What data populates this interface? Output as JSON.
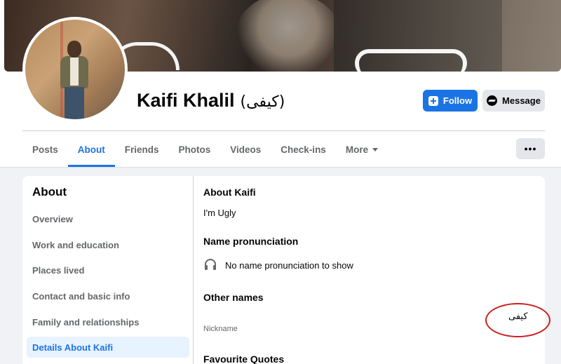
{
  "profile": {
    "name": "Kaifi Khalil",
    "alt_name": "(کیفی)"
  },
  "actions": {
    "follow_label": "Follow",
    "message_label": "Message",
    "more_dots": "•••"
  },
  "tabs": [
    {
      "label": "Posts"
    },
    {
      "label": "About",
      "active": true
    },
    {
      "label": "Friends"
    },
    {
      "label": "Photos"
    },
    {
      "label": "Videos"
    },
    {
      "label": "Check-ins"
    },
    {
      "label": "More"
    }
  ],
  "about": {
    "title": "About",
    "sidebar": [
      {
        "label": "Overview"
      },
      {
        "label": "Work and education"
      },
      {
        "label": "Places lived"
      },
      {
        "label": "Contact and basic info"
      },
      {
        "label": "Family and relationships"
      },
      {
        "label": "Details About Kaifi",
        "active": true
      }
    ],
    "details": {
      "about_heading": "About Kaifi",
      "about_text": "I'm Ugly",
      "pronunciation_heading": "Name pronunciation",
      "pronunciation_text": "No name pronunciation to show",
      "other_names_heading": "Other names",
      "nickname_label": "Nickname",
      "nickname_value": "کیفی",
      "quotes_heading": "Favourite Quotes"
    }
  },
  "colors": {
    "accent": "#1b74e4",
    "annotation_circle": "#cc1f1f"
  }
}
